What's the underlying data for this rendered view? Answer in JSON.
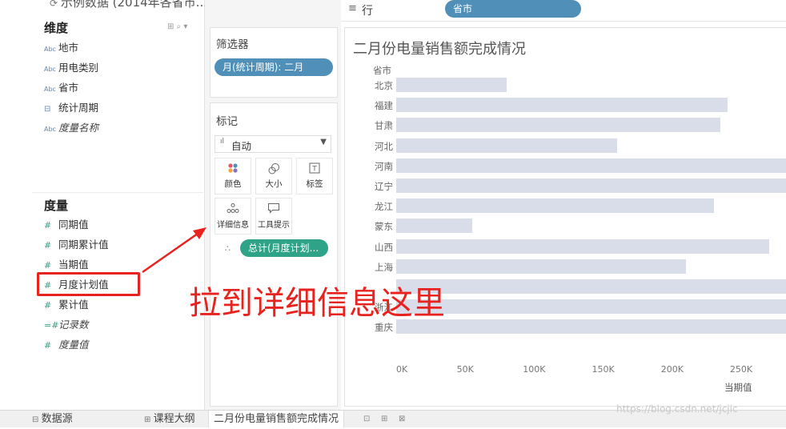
{
  "data_pane": {
    "datasource": "示例数据 (2014年各省市...",
    "dimensions_title": "维度",
    "dimensions": [
      {
        "type": "Abc",
        "label": "地市",
        "italic": false
      },
      {
        "type": "Abc",
        "label": "用电类别",
        "italic": false
      },
      {
        "type": "Abc",
        "label": "省市",
        "italic": false
      },
      {
        "type": "date",
        "label": "统计周期",
        "italic": false
      },
      {
        "type": "Abc",
        "label": "度量名称",
        "italic": true
      }
    ],
    "measures_title": "度量",
    "measures": [
      {
        "label": "同期值",
        "italic": false
      },
      {
        "label": "同期累计值",
        "italic": false
      },
      {
        "label": "当期值",
        "italic": false
      },
      {
        "label": "月度计划值",
        "italic": false
      },
      {
        "label": "累计值",
        "italic": false
      },
      {
        "label": "记录数",
        "italic": true
      },
      {
        "label": "度量值",
        "italic": true
      }
    ]
  },
  "filters": {
    "title": "筛选器",
    "pill": "月(统计周期): 二月"
  },
  "marks": {
    "title": "标记",
    "type_select": "自动",
    "buttons": [
      {
        "label": "颜色",
        "icon": "color-icon"
      },
      {
        "label": "大小",
        "icon": "size-icon"
      },
      {
        "label": "标签",
        "icon": "label-icon"
      },
      {
        "label": "详细信息",
        "icon": "detail-icon"
      },
      {
        "label": "工具提示",
        "icon": "tooltip-icon"
      }
    ],
    "detail_pill": "总计(月度计划..."
  },
  "rows_shelf": {
    "label": "行",
    "pill": "省市"
  },
  "chart_data": {
    "type": "bar",
    "orientation": "horizontal",
    "title": "二月份电量销售额完成情况",
    "category_header": "省市",
    "categories": [
      "北京",
      "福建",
      "甘肃",
      "河北",
      "河南",
      "辽宁",
      "龙江",
      "蒙东",
      "山西",
      "上海",
      "",
      "浙江",
      "重庆"
    ],
    "series": [
      {
        "values": [
          80000,
          240000,
          235000,
          160000,
          300000,
          300000,
          230000,
          55000,
          270000,
          210000,
          300000,
          300000,
          300000
        ]
      }
    ],
    "x_ticks": [
      "0K",
      "50K",
      "100K",
      "150K",
      "200K",
      "250K"
    ],
    "xlabel": "当期值",
    "xlim": [
      0,
      290000
    ],
    "bar_color": "#d8dde9"
  },
  "tabs": [
    {
      "label": "数据源",
      "icon": "datasource-icon"
    },
    {
      "label": "课程大纲",
      "icon": "sheet-icon"
    },
    {
      "label": "二月份电量销售额完成情况",
      "active": true
    }
  ],
  "annotation": {
    "text": "拉到详细信息这里",
    "color": "#e8221e"
  },
  "watermark": "https://blog.csdn.net/jcjic"
}
